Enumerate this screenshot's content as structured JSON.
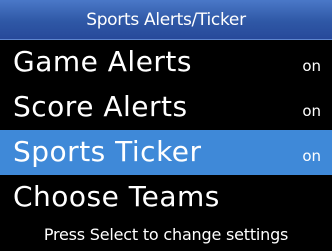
{
  "screen": {
    "title": "Sports Alerts/Ticker",
    "hint": "Press Select to change settings"
  },
  "menu": {
    "items": [
      {
        "label": "Game Alerts",
        "value": "on",
        "selected": false
      },
      {
        "label": "Score Alerts",
        "value": "on",
        "selected": false
      },
      {
        "label": "Sports Ticker",
        "value": "on",
        "selected": true
      },
      {
        "label": "Choose Teams",
        "value": "",
        "selected": false
      }
    ]
  },
  "colors": {
    "background": "#000000",
    "title_bar": "#2f58a6",
    "selection_highlight": "#3f89d8",
    "text": "#ffffff"
  }
}
